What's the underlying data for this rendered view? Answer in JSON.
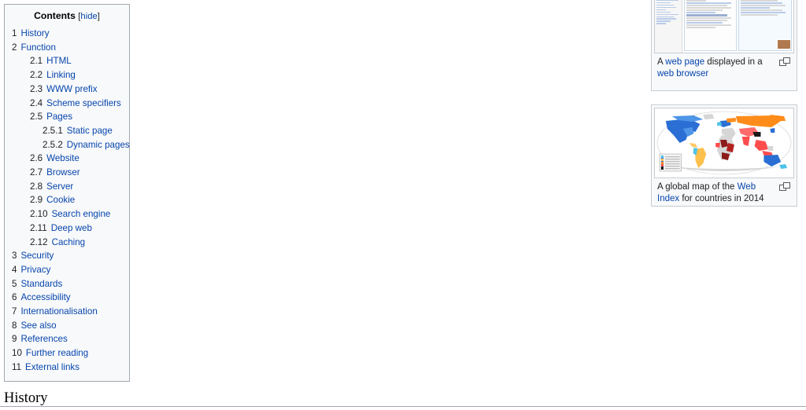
{
  "toc": {
    "title": "Contents",
    "toggle_open_bracket": "[",
    "toggle_label": "hide",
    "toggle_close_bracket": "]",
    "items": [
      {
        "num": "1",
        "label": "History",
        "level": 1
      },
      {
        "num": "2",
        "label": "Function",
        "level": 1
      },
      {
        "num": "2.1",
        "label": "HTML",
        "level": 2
      },
      {
        "num": "2.2",
        "label": "Linking",
        "level": 2
      },
      {
        "num": "2.3",
        "label": "WWW prefix",
        "level": 2
      },
      {
        "num": "2.4",
        "label": "Scheme specifiers",
        "level": 2
      },
      {
        "num": "2.5",
        "label": "Pages",
        "level": 2
      },
      {
        "num": "2.5.1",
        "label": "Static page",
        "level": 3
      },
      {
        "num": "2.5.2",
        "label": "Dynamic pages",
        "level": 3
      },
      {
        "num": "2.6",
        "label": "Website",
        "level": 2
      },
      {
        "num": "2.7",
        "label": "Browser",
        "level": 2
      },
      {
        "num": "2.8",
        "label": "Server",
        "level": 2
      },
      {
        "num": "2.9",
        "label": "Cookie",
        "level": 2
      },
      {
        "num": "2.10",
        "label": "Search engine",
        "level": 2
      },
      {
        "num": "2.11",
        "label": "Deep web",
        "level": 2
      },
      {
        "num": "2.12",
        "label": "Caching",
        "level": 2
      },
      {
        "num": "3",
        "label": "Security",
        "level": 1
      },
      {
        "num": "4",
        "label": "Privacy",
        "level": 1
      },
      {
        "num": "5",
        "label": "Standards",
        "level": 1
      },
      {
        "num": "6",
        "label": "Accessibility",
        "level": 1
      },
      {
        "num": "7",
        "label": "Internationalisation",
        "level": 1
      },
      {
        "num": "8",
        "label": "See also",
        "level": 1
      },
      {
        "num": "9",
        "label": "References",
        "level": 1
      },
      {
        "num": "10",
        "label": "Further reading",
        "level": 1
      },
      {
        "num": "11",
        "label": "External links",
        "level": 1
      }
    ]
  },
  "thumbnails": [
    {
      "name": "web-page-screenshot",
      "caption_parts": [
        {
          "text": "A ",
          "link": false
        },
        {
          "text": "web page",
          "link": true
        },
        {
          "text": " displayed in a ",
          "link": false
        },
        {
          "text": "web browser",
          "link": true
        },
        {
          "text": "",
          "link": false
        }
      ],
      "caption_plain": "A web page displayed in a web browser",
      "enlarge_icon": "enlarge-icon"
    },
    {
      "name": "web-index-map",
      "caption_parts": [
        {
          "text": "A global map of the ",
          "link": false
        },
        {
          "text": "Web Index",
          "link": true
        },
        {
          "text": " for countries in 2014",
          "link": false
        }
      ],
      "caption_plain": "A global map of the Web Index for countries in 2014",
      "enlarge_icon": "enlarge-icon"
    }
  ],
  "section": {
    "heading": "History"
  },
  "colors": {
    "link": "#0645ad",
    "text": "#202122",
    "toc_border": "#a2a9b1",
    "toc_background": "#f8f9fa",
    "thumb_border": "#c8ccd1",
    "page_background": "#ffffff"
  }
}
